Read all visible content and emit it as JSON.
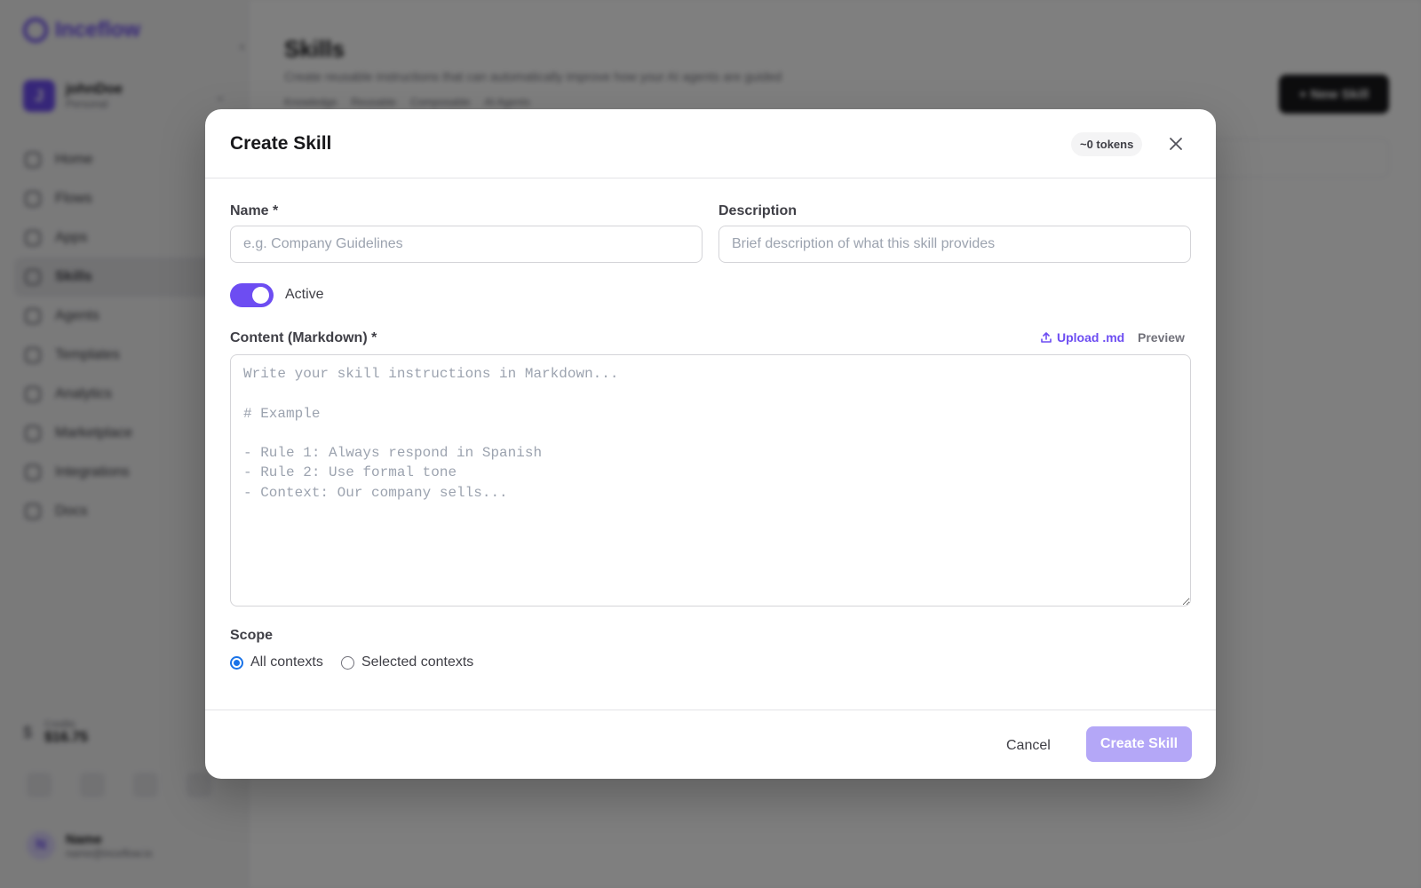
{
  "background": {
    "logo": {
      "text": "Inceflow"
    },
    "workspace": {
      "initial": "J",
      "name": "johnDoe",
      "plan": "Personal"
    },
    "nav": [
      {
        "label": "Home",
        "icon": "home-icon"
      },
      {
        "label": "Flows",
        "icon": "flows-icon"
      },
      {
        "label": "Apps",
        "icon": "apps-icon"
      },
      {
        "label": "Skills",
        "icon": "skills-icon",
        "active": true
      },
      {
        "label": "Agents",
        "icon": "agents-icon"
      },
      {
        "label": "Templates",
        "icon": "templates-icon"
      },
      {
        "label": "Analytics",
        "icon": "analytics-icon"
      },
      {
        "label": "Marketplace",
        "icon": "marketplace-icon"
      },
      {
        "label": "Integrations",
        "icon": "integrations-icon"
      },
      {
        "label": "Docs",
        "icon": "docs-icon"
      }
    ],
    "credits": {
      "label": "Credits",
      "value": "$16.75"
    },
    "user": {
      "initial": "N",
      "name": "Name",
      "email": "name@inceflow.io"
    },
    "page": {
      "title": "Skills",
      "subtitle": "Create reusable instructions that can automatically improve how your AI agents are guided",
      "meta": [
        "Knowledge",
        "Reusable",
        "Composable",
        "AI Agents"
      ],
      "new_button": "+ New Skill"
    }
  },
  "modal": {
    "title": "Create Skill",
    "token_badge": "~0 tokens",
    "name": {
      "label": "Name *",
      "value": "",
      "placeholder": "e.g. Company Guidelines"
    },
    "description": {
      "label": "Description",
      "value": "",
      "placeholder": "Brief description of what this skill provides"
    },
    "active": {
      "label": "Active",
      "on": true
    },
    "content": {
      "label": "Content (Markdown) *",
      "upload_label": "Upload .md",
      "preview_label": "Preview",
      "value": "",
      "placeholder": "Write your skill instructions in Markdown...\n\n# Example\n\n- Rule 1: Always respond in Spanish\n- Rule 2: Use formal tone\n- Context: Our company sells..."
    },
    "scope": {
      "label": "Scope",
      "options": [
        {
          "label": "All contexts",
          "selected": true
        },
        {
          "label": "Selected contexts",
          "selected": false
        }
      ]
    },
    "footer": {
      "cancel_label": "Cancel",
      "create_label": "Create Skill"
    }
  },
  "colors": {
    "accent": "#6d4df2",
    "accent_disabled": "#b4a7f7",
    "radio": "#1a73e8"
  }
}
